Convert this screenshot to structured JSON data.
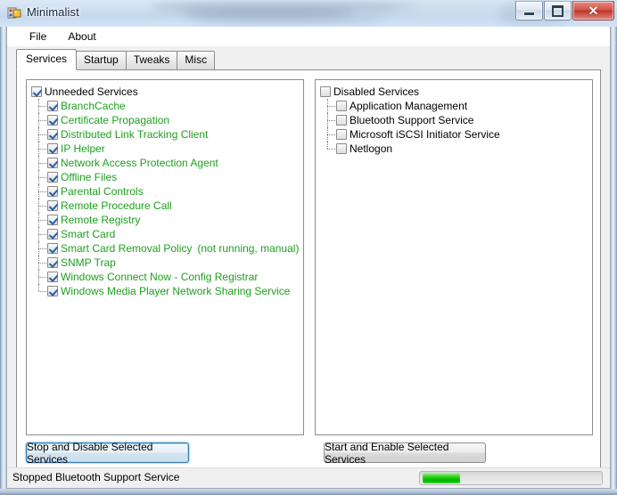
{
  "window": {
    "title": "Minimalist",
    "icon": "app-icon",
    "controls": {
      "minimize": "minimize-button",
      "maximize": "maximize-button",
      "close_glyph": "✕"
    }
  },
  "menu": {
    "items": [
      {
        "label": "File"
      },
      {
        "label": "About"
      }
    ]
  },
  "tabs": [
    {
      "label": "Services",
      "active": true
    },
    {
      "label": "Startup",
      "active": false
    },
    {
      "label": "Tweaks",
      "active": false
    },
    {
      "label": "Misc",
      "active": false
    }
  ],
  "left_tree": {
    "root": {
      "label": "Unneeded Services",
      "checked": true
    },
    "items": [
      {
        "label": "BranchCache",
        "checked": true,
        "note": ""
      },
      {
        "label": "Certificate Propagation",
        "checked": true,
        "note": ""
      },
      {
        "label": "Distributed Link Tracking Client",
        "checked": true,
        "note": ""
      },
      {
        "label": "IP Helper",
        "checked": true,
        "note": ""
      },
      {
        "label": "Network Access Protection Agent",
        "checked": true,
        "note": ""
      },
      {
        "label": "Offline Files",
        "checked": true,
        "note": ""
      },
      {
        "label": "Parental Controls",
        "checked": true,
        "note": ""
      },
      {
        "label": "Remote Procedure Call",
        "checked": true,
        "note": ""
      },
      {
        "label": "Remote Registry",
        "checked": true,
        "note": ""
      },
      {
        "label": "Smart Card",
        "checked": true,
        "note": ""
      },
      {
        "label": "Smart Card Removal Policy",
        "checked": true,
        "note": "(not running, manual)"
      },
      {
        "label": "SNMP Trap",
        "checked": true,
        "note": ""
      },
      {
        "label": "Windows Connect Now - Config Registrar",
        "checked": true,
        "note": ""
      },
      {
        "label": "Windows Media Player Network Sharing Service",
        "checked": true,
        "note": ""
      }
    ]
  },
  "right_tree": {
    "root": {
      "label": "Disabled Services",
      "checked": false
    },
    "items": [
      {
        "label": "Application Management",
        "checked": false,
        "note": ""
      },
      {
        "label": "Bluetooth Support Service",
        "checked": false,
        "note": ""
      },
      {
        "label": "Microsoft iSCSI Initiator Service",
        "checked": false,
        "note": ""
      },
      {
        "label": "Netlogon",
        "checked": false,
        "note": ""
      }
    ]
  },
  "buttons": {
    "stop_label": "Stop and Disable Selected Services",
    "start_label": "Start and Enable Selected Services"
  },
  "statusbar": {
    "text": "Stopped Bluetooth Support Service",
    "progress_percent": 21
  },
  "colors": {
    "service_green": "#1ea01e",
    "progress_green": "#12c800",
    "focus_blue": "#3c7fb1",
    "close_red": "#bf3327"
  }
}
